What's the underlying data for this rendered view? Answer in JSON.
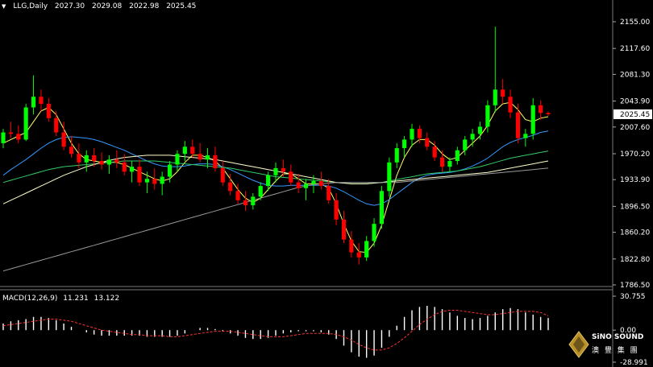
{
  "header": {
    "symbol": "LLG,Daily",
    "open": "2027.30",
    "high": "2029.08",
    "low": "2022.98",
    "close": "2025.45"
  },
  "macd_header": {
    "label": "MACD(12,26,9)",
    "main": "11.231",
    "signal": "13.122"
  },
  "logo": {
    "name": "SiNO SOUND",
    "sub": "澳 豐 集 團"
  },
  "colors": {
    "background": "#000000",
    "bull": "#00ff00",
    "bear": "#ff0000",
    "price_tag_bg": "#ffffff",
    "ma_fast": "#ffff66",
    "ma_blue": "#3399ff",
    "ma_green": "#33cc66",
    "ma_cream": "#ffffcc",
    "ma_gray": "#9a9a9a",
    "macd_hist": "#ffffff",
    "macd_signal": "#ff3333"
  },
  "chart_data": [
    {
      "type": "candlestick",
      "title": "LLG,Daily",
      "y_ticks": [
        "2155.00",
        "2117.60",
        "2081.30",
        "2043.90",
        "2007.60",
        "1970.20",
        "1933.90",
        "1896.50",
        "1860.20",
        "1822.80",
        "1786.50"
      ],
      "ylim": [
        1786.5,
        2155.0
      ],
      "current_price": "2025.45",
      "candles": [
        [
          1985,
          2005,
          1978,
          2000
        ],
        [
          2000,
          2015,
          1992,
          1998
        ],
        [
          1998,
          2010,
          1985,
          1990
        ],
        [
          1990,
          2040,
          1988,
          2035
        ],
        [
          2035,
          2080,
          2025,
          2050
        ],
        [
          2050,
          2060,
          2030,
          2040
        ],
        [
          2040,
          2048,
          2015,
          2020
        ],
        [
          2020,
          2030,
          1995,
          2000
        ],
        [
          2000,
          2015,
          1975,
          1980
        ],
        [
          1980,
          1995,
          1965,
          1970
        ],
        [
          1970,
          1985,
          1950,
          1958
        ],
        [
          1958,
          1975,
          1945,
          1968
        ],
        [
          1968,
          1978,
          1952,
          1960
        ],
        [
          1960,
          1972,
          1948,
          1955
        ],
        [
          1955,
          1968,
          1942,
          1962
        ],
        [
          1962,
          1975,
          1950,
          1958
        ],
        [
          1958,
          1970,
          1940,
          1945
        ],
        [
          1945,
          1960,
          1930,
          1952
        ],
        [
          1952,
          1962,
          1925,
          1930
        ],
        [
          1930,
          1945,
          1915,
          1935
        ],
        [
          1935,
          1950,
          1920,
          1928
        ],
        [
          1928,
          1945,
          1912,
          1938
        ],
        [
          1938,
          1960,
          1930,
          1955
        ],
        [
          1955,
          1975,
          1945,
          1970
        ],
        [
          1970,
          1988,
          1960,
          1980
        ],
        [
          1980,
          1990,
          1965,
          1970
        ],
        [
          1970,
          1985,
          1958,
          1962
        ],
        [
          1962,
          1978,
          1950,
          1968
        ],
        [
          1968,
          1980,
          1945,
          1950
        ],
        [
          1950,
          1960,
          1925,
          1930
        ],
        [
          1930,
          1942,
          1912,
          1918
        ],
        [
          1918,
          1928,
          1900,
          1905
        ],
        [
          1905,
          1918,
          1890,
          1898
        ],
        [
          1898,
          1915,
          1892,
          1910
        ],
        [
          1910,
          1930,
          1905,
          1925
        ],
        [
          1925,
          1945,
          1918,
          1940
        ],
        [
          1940,
          1958,
          1930,
          1950
        ],
        [
          1950,
          1962,
          1938,
          1945
        ],
        [
          1945,
          1955,
          1925,
          1930
        ],
        [
          1930,
          1942,
          1915,
          1922
        ],
        [
          1922,
          1935,
          1905,
          1928
        ],
        [
          1928,
          1940,
          1915,
          1932
        ],
        [
          1932,
          1945,
          1920,
          1925
        ],
        [
          1925,
          1935,
          1900,
          1905
        ],
        [
          1905,
          1915,
          1870,
          1878
        ],
        [
          1878,
          1890,
          1845,
          1850
        ],
        [
          1850,
          1862,
          1825,
          1832
        ],
        [
          1832,
          1845,
          1815,
          1825
        ],
        [
          1825,
          1855,
          1820,
          1848
        ],
        [
          1848,
          1880,
          1840,
          1872
        ],
        [
          1872,
          1925,
          1865,
          1918
        ],
        [
          1918,
          1965,
          1910,
          1958
        ],
        [
          1958,
          1985,
          1950,
          1978
        ],
        [
          1978,
          1995,
          1965,
          1990
        ],
        [
          1990,
          2012,
          1980,
          2005
        ],
        [
          2005,
          2010,
          1985,
          1992
        ],
        [
          1992,
          2000,
          1975,
          1980
        ],
        [
          1980,
          1988,
          1960,
          1965
        ],
        [
          1965,
          1975,
          1945,
          1952
        ],
        [
          1952,
          1965,
          1945,
          1960
        ],
        [
          1960,
          1980,
          1955,
          1975
        ],
        [
          1975,
          1995,
          1968,
          1990
        ],
        [
          1990,
          2005,
          1980,
          1998
        ],
        [
          1998,
          2015,
          1990,
          2008
        ],
        [
          2008,
          2045,
          2000,
          2038
        ],
        [
          2038,
          2148,
          2028,
          2060
        ],
        [
          2060,
          2075,
          2040,
          2050
        ],
        [
          2050,
          2060,
          2020,
          2028
        ],
        [
          2028,
          2040,
          1985,
          1992
        ],
        [
          1992,
          2005,
          1980,
          1998
        ],
        [
          1998,
          2048,
          1990,
          2038
        ],
        [
          2038,
          2045,
          2018,
          2027.3
        ],
        [
          2027.3,
          2029.08,
          2022.98,
          2025.45
        ]
      ],
      "ma_series": [
        {
          "color_key": "ma_fast",
          "values": [
            1985,
            1990,
            1995,
            2000,
            2015,
            2030,
            2035,
            2025,
            2005,
            1985,
            1970,
            1962,
            1960,
            1958,
            1958,
            1958,
            1955,
            1950,
            1945,
            1940,
            1935,
            1932,
            1935,
            1945,
            1958,
            1968,
            1968,
            1965,
            1960,
            1950,
            1935,
            1920,
            1908,
            1902,
            1908,
            1920,
            1932,
            1942,
            1942,
            1935,
            1928,
            1928,
            1928,
            1922,
            1900,
            1872,
            1848,
            1833,
            1832,
            1845,
            1870,
            1905,
            1940,
            1965,
            1982,
            1990,
            1990,
            1982,
            1970,
            1962,
            1965,
            1975,
            1985,
            1995,
            2010,
            2030,
            2040,
            2042,
            2032,
            2018,
            2015,
            2020,
            2022
          ]
        },
        {
          "color_key": "ma_blue",
          "values": [
            1940,
            1948,
            1955,
            1962,
            1970,
            1978,
            1985,
            1990,
            1993,
            1994,
            1993,
            1992,
            1990,
            1987,
            1983,
            1979,
            1975,
            1970,
            1965,
            1960,
            1956,
            1953,
            1952,
            1952,
            1953,
            1955,
            1956,
            1956,
            1955,
            1952,
            1948,
            1943,
            1938,
            1933,
            1929,
            1926,
            1925,
            1925,
            1926,
            1926,
            1926,
            1926,
            1926,
            1925,
            1922,
            1917,
            1911,
            1905,
            1900,
            1898,
            1900,
            1906,
            1914,
            1922,
            1930,
            1936,
            1940,
            1942,
            1943,
            1944,
            1946,
            1949,
            1953,
            1958,
            1964,
            1972,
            1980,
            1986,
            1990,
            1993,
            1996,
            2000,
            2002
          ]
        },
        {
          "color_key": "ma_green",
          "values": [
            1930,
            1933,
            1936,
            1939,
            1942,
            1945,
            1948,
            1950,
            1952,
            1953,
            1954,
            1955,
            1956,
            1957,
            1958,
            1959,
            1960,
            1960,
            1960,
            1960,
            1960,
            1959,
            1958,
            1957,
            1956,
            1955,
            1954,
            1953,
            1952,
            1951,
            1950,
            1948,
            1946,
            1944,
            1942,
            1940,
            1938,
            1937,
            1936,
            1935,
            1934,
            1933,
            1932,
            1931,
            1930,
            1929,
            1928,
            1928,
            1928,
            1929,
            1930,
            1932,
            1934,
            1936,
            1938,
            1940,
            1942,
            1943,
            1944,
            1945,
            1946,
            1948,
            1950,
            1952,
            1955,
            1958,
            1961,
            1964,
            1966,
            1968,
            1970,
            1972,
            1974
          ]
        },
        {
          "color_key": "ma_cream",
          "values": [
            1900,
            1905,
            1910,
            1915,
            1920,
            1925,
            1930,
            1935,
            1940,
            1944,
            1948,
            1952,
            1955,
            1958,
            1961,
            1963,
            1965,
            1966,
            1967,
            1968,
            1968,
            1968,
            1968,
            1967,
            1966,
            1965,
            1964,
            1963,
            1962,
            1960,
            1958,
            1956,
            1954,
            1952,
            1950,
            1948,
            1946,
            1944,
            1942,
            1940,
            1938,
            1936,
            1934,
            1932,
            1930,
            1929,
            1928,
            1928,
            1928,
            1929,
            1930,
            1931,
            1932,
            1933,
            1934,
            1935,
            1936,
            1937,
            1938,
            1939,
            1940,
            1941,
            1942,
            1943,
            1944,
            1946,
            1948,
            1950,
            1952,
            1954,
            1956,
            1958,
            1960
          ]
        },
        {
          "color_key": "ma_gray",
          "values": [
            1806,
            1809,
            1812,
            1815,
            1818,
            1821,
            1824,
            1827,
            1830,
            1833,
            1836,
            1839,
            1842,
            1845,
            1848,
            1851,
            1854,
            1857,
            1860,
            1863,
            1866,
            1869,
            1872,
            1875,
            1878,
            1881,
            1884,
            1887,
            1890,
            1893,
            1896,
            1899,
            1902,
            1905,
            1908,
            1911,
            1914,
            1917,
            1920,
            1923,
            1925,
            1927,
            1928,
            1929,
            1930,
            1930,
            1930,
            1930,
            1930,
            1930,
            1930,
            1930,
            1930,
            1931,
            1932,
            1933,
            1934,
            1935,
            1936,
            1937,
            1938,
            1939,
            1940,
            1941,
            1942,
            1943,
            1944,
            1945,
            1946,
            1947,
            1948,
            1949,
            1950
          ]
        }
      ]
    },
    {
      "type": "bar",
      "title": "MACD(12,26,9)",
      "y_ticks": [
        "30.755",
        "0.00",
        "-28.991"
      ],
      "ylim": [
        -28.991,
        30.755
      ],
      "histogram": [
        6,
        8,
        9,
        10,
        12,
        12,
        11,
        9,
        6,
        3,
        0,
        -2,
        -4,
        -5,
        -5,
        -5,
        -5,
        -5,
        -5,
        -6,
        -6,
        -6,
        -6,
        -5,
        -3,
        0,
        2,
        2,
        1,
        -1,
        -3,
        -5,
        -7,
        -8,
        -8,
        -7,
        -5,
        -3,
        -2,
        -1,
        -1,
        -1,
        -2,
        -4,
        -8,
        -14,
        -20,
        -24,
        -25,
        -23,
        -16,
        -6,
        4,
        12,
        18,
        21,
        22,
        21,
        19,
        16,
        13,
        11,
        10,
        11,
        13,
        16,
        19,
        20,
        19,
        16,
        14,
        12,
        11
      ],
      "signal": [
        4,
        5,
        6,
        7,
        8,
        9,
        10,
        10,
        9,
        8,
        6,
        4,
        2,
        0,
        -1,
        -2,
        -3,
        -4,
        -4,
        -5,
        -5,
        -5,
        -6,
        -6,
        -5,
        -4,
        -3,
        -2,
        -1,
        -1,
        -1,
        -2,
        -3,
        -4,
        -5,
        -6,
        -6,
        -6,
        -5,
        -4,
        -3,
        -3,
        -3,
        -3,
        -4,
        -6,
        -9,
        -13,
        -16,
        -18,
        -18,
        -16,
        -12,
        -7,
        -1,
        5,
        10,
        14,
        17,
        18,
        18,
        17,
        16,
        15,
        14,
        14,
        15,
        16,
        17,
        17,
        17,
        16,
        13
      ]
    }
  ]
}
